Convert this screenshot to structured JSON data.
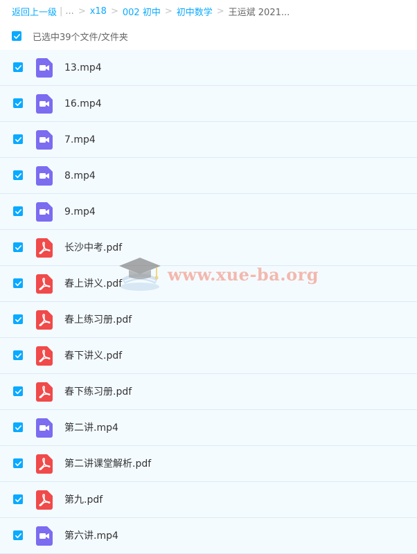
{
  "breadcrumb": {
    "back": "返回上一级",
    "ellipsis": "...",
    "separator": ">",
    "items": [
      "x18",
      "002 初中",
      "初中数学"
    ],
    "current": "王运斌 2021..."
  },
  "selection": {
    "label": "已选中39个文件/文件夹"
  },
  "files": [
    {
      "name": "13.mp4",
      "type": "video-icon"
    },
    {
      "name": "16.mp4",
      "type": "video-icon"
    },
    {
      "name": "7.mp4",
      "type": "video-icon"
    },
    {
      "name": "8.mp4",
      "type": "video-icon"
    },
    {
      "name": "9.mp4",
      "type": "video-icon"
    },
    {
      "name": "长沙中考.pdf",
      "type": "pdf-icon"
    },
    {
      "name": "春上讲义.pdf",
      "type": "pdf-icon"
    },
    {
      "name": "春上练习册.pdf",
      "type": "pdf-icon"
    },
    {
      "name": "春下讲义.pdf",
      "type": "pdf-icon"
    },
    {
      "name": "春下练习册.pdf",
      "type": "pdf-icon"
    },
    {
      "name": "第二讲.mp4",
      "type": "video-icon"
    },
    {
      "name": "第二讲课堂解析.pdf",
      "type": "pdf-icon"
    },
    {
      "name": "第九.pdf",
      "type": "pdf-icon"
    },
    {
      "name": "第六讲.mp4",
      "type": "video-icon"
    }
  ],
  "watermark": {
    "text": "www.xue-ba.org"
  },
  "colors": {
    "accent": "#09aaff",
    "video": "#7b6cf0",
    "pdf": "#f04a4a",
    "row_bg": "#f4fbff"
  }
}
